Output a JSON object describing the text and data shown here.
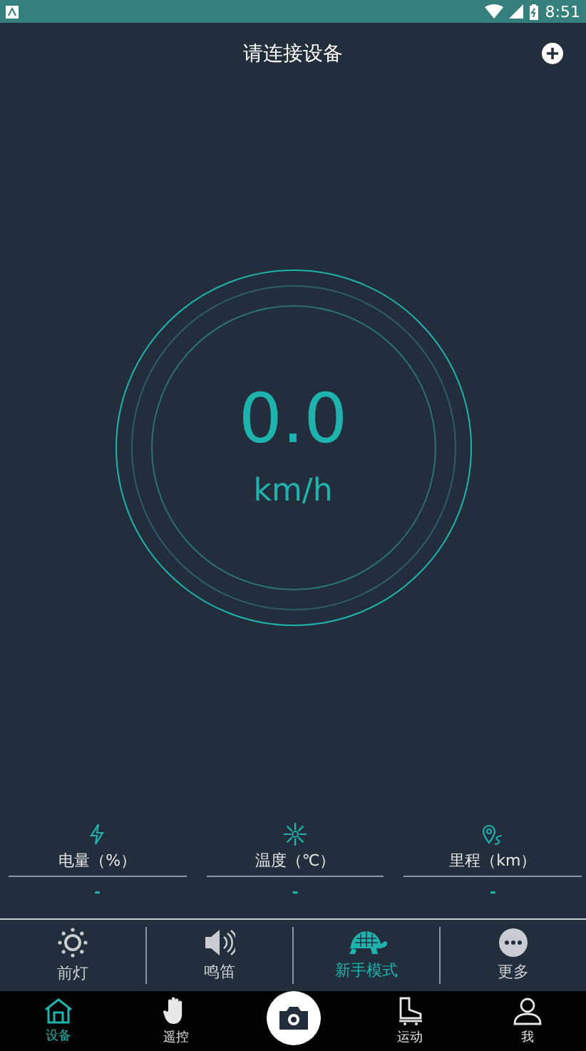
{
  "status_bar": {
    "time": "8:51"
  },
  "header": {
    "title": "请连接设备"
  },
  "gauge": {
    "speed": "0.0",
    "unit": "km/h"
  },
  "stats": [
    {
      "kind": "battery",
      "label": "电量（%）",
      "value": "-"
    },
    {
      "kind": "temperature",
      "label": "温度（℃）",
      "value": "-"
    },
    {
      "kind": "distance",
      "label": "里程（km）",
      "value": "-"
    }
  ],
  "controls": [
    {
      "kind": "light",
      "label": "前灯",
      "selected": false
    },
    {
      "kind": "horn",
      "label": "鸣笛",
      "selected": false
    },
    {
      "kind": "turtle",
      "label": "新手模式",
      "selected": true
    },
    {
      "kind": "more",
      "label": "更多",
      "selected": false
    }
  ],
  "tabs": [
    {
      "kind": "home",
      "label": "设备",
      "selected": true
    },
    {
      "kind": "hand",
      "label": "遥控",
      "selected": false
    },
    {
      "kind": "camera",
      "selected": false
    },
    {
      "kind": "skate",
      "label": "运动",
      "selected": false
    },
    {
      "kind": "person",
      "label": "我",
      "selected": false
    }
  ]
}
